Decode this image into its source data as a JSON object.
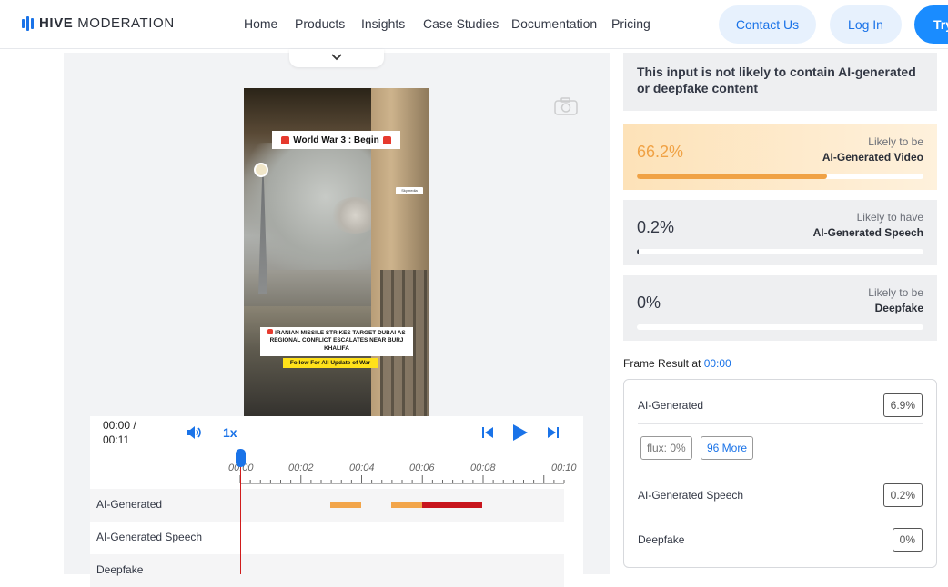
{
  "brand": {
    "name_bold": "HIVE",
    "name_light": "MODERATION",
    "accent": "#1a73e8"
  },
  "nav": {
    "links": [
      "Home",
      "Products",
      "Insights",
      "Case Studies",
      "Documentation",
      "Pricing"
    ],
    "contact_label": "Contact Us",
    "login_label": "Log In",
    "try_label": "Try"
  },
  "video": {
    "title_text": "World War 3 : Begin",
    "watermark": "Skymedia",
    "caption": "IRANIAN MISSILE STRIKES TARGET DUBAI AS REGIONAL CONFLICT ESCALATES NEAR BURJ KHALIFA",
    "follow_text": "Follow For All Update of War"
  },
  "player": {
    "time_current": "00:00 /",
    "time_total": "00:11",
    "speed": "1x",
    "ticks": [
      "00:00",
      "00:02",
      "00:04",
      "00:06",
      "00:08",
      "00:10"
    ],
    "tracks": [
      {
        "label": "AI-Generated"
      },
      {
        "label": "AI-Generated Speech"
      },
      {
        "label": "Deepfake"
      }
    ]
  },
  "summary": {
    "prefix": "This input is ",
    "emphasis": "not likely to contain AI-generated or deepfake content"
  },
  "cards": [
    {
      "pct": "66.2%",
      "line1": "Likely to be",
      "line2": "AI-Generated Video",
      "value": 0.662,
      "color": "#f0a245"
    },
    {
      "pct": "0.2%",
      "line1": "Likely to have",
      "line2": "AI-Generated Speech",
      "value": 0.002,
      "color": "#333845"
    },
    {
      "pct": "0%",
      "line1": "Likely to be",
      "line2": "Deepfake",
      "value": 0.0,
      "color": "#333845"
    }
  ],
  "frame": {
    "heading": "Frame Result at",
    "timestamp": "00:00",
    "rows": [
      {
        "label": "AI-Generated",
        "value": "6.9%"
      },
      {
        "label": "AI-Generated Speech",
        "value": "0.2%"
      },
      {
        "label": "Deepfake",
        "value": "0%"
      }
    ],
    "chip_flux": "flux: 0%",
    "chip_more": "96 More"
  }
}
